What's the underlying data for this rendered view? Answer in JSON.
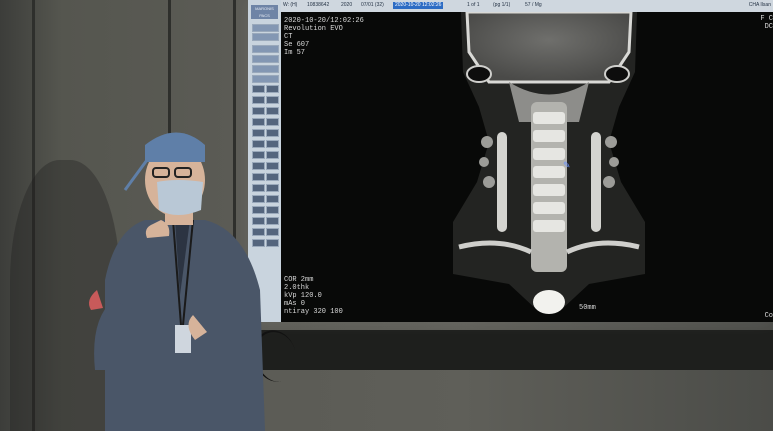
{
  "screen": {
    "top_bar": {
      "items": [
        "W: (H)",
        "10838642",
        "2020",
        "07/01 (32)",
        "2020-10-20 12:02:26",
        "1 of 1",
        "(pg 1/1)",
        "57 / Mg"
      ],
      "right_label": "CHA Ilsan"
    },
    "left_toolbar": {
      "logo_text": "MARONIS PACS"
    },
    "overlay_top_left": {
      "datetime": "2020-10-20/12:02:26",
      "scanner": "Revolution EVO",
      "modality": "CT",
      "series": "Se 607",
      "image": "Im 57"
    },
    "overlay_top_right": {
      "line1": "F C",
      "line2": "DC"
    },
    "overlay_bottom_left": {
      "plane": "COR 2mm",
      "thickness": "2.0thk",
      "kvp": "kVp 120.0",
      "mas": "mAs 0",
      "contrast": "ntiray 320 100"
    },
    "overlay_bottom_center": {
      "scale": "50mm"
    },
    "overlay_bottom_right": {
      "text": "Co"
    }
  },
  "scene": {
    "wall_color": "#5b5b55",
    "screen_bg": "#0c0d0c",
    "scrubs_color": "#4a5668",
    "cap_color": "#5f7fa8",
    "mask_color": "#b9c8d6"
  }
}
